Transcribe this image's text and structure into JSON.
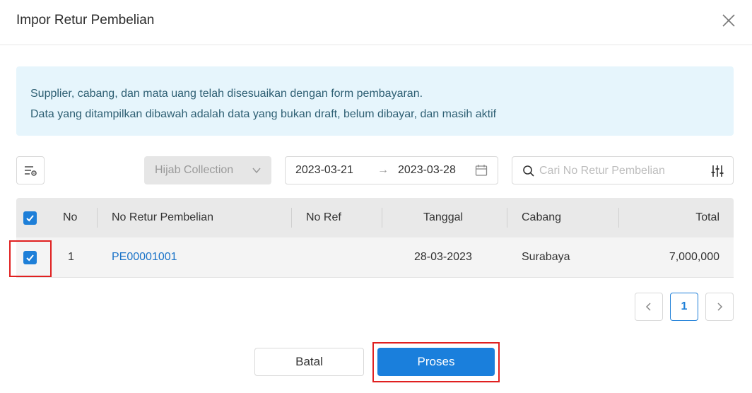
{
  "modal": {
    "title": "Impor Retur Pembelian"
  },
  "info": {
    "line1": "Supplier, cabang, dan mata uang telah disesuaikan dengan form pembayaran.",
    "line2": "Data yang ditampilkan dibawah adalah data yang bukan draft, belum dibayar, dan masih aktif"
  },
  "filters": {
    "branch_select": "Hijab Collection",
    "date_start": "2023-03-21",
    "date_arrow": "→",
    "date_end": "2023-03-28",
    "search_placeholder": "Cari No Retur Pembelian",
    "search_value": ""
  },
  "table": {
    "headers": {
      "no": "No",
      "no_retur": "No Retur Pembelian",
      "no_ref": "No Ref",
      "tanggal": "Tanggal",
      "cabang": "Cabang",
      "total": "Total"
    },
    "rows": [
      {
        "checked": true,
        "no": "1",
        "no_retur": "PE00001001",
        "no_ref": "",
        "tanggal": "28-03-2023",
        "cabang": "Surabaya",
        "total": "7,000,000"
      }
    ]
  },
  "pagination": {
    "current": "1"
  },
  "actions": {
    "cancel": "Batal",
    "process": "Proses"
  },
  "colors": {
    "primary": "#1a7fdc",
    "highlight": "#e02020",
    "info_bg": "#e6f5fc",
    "link": "#1a73c8"
  }
}
